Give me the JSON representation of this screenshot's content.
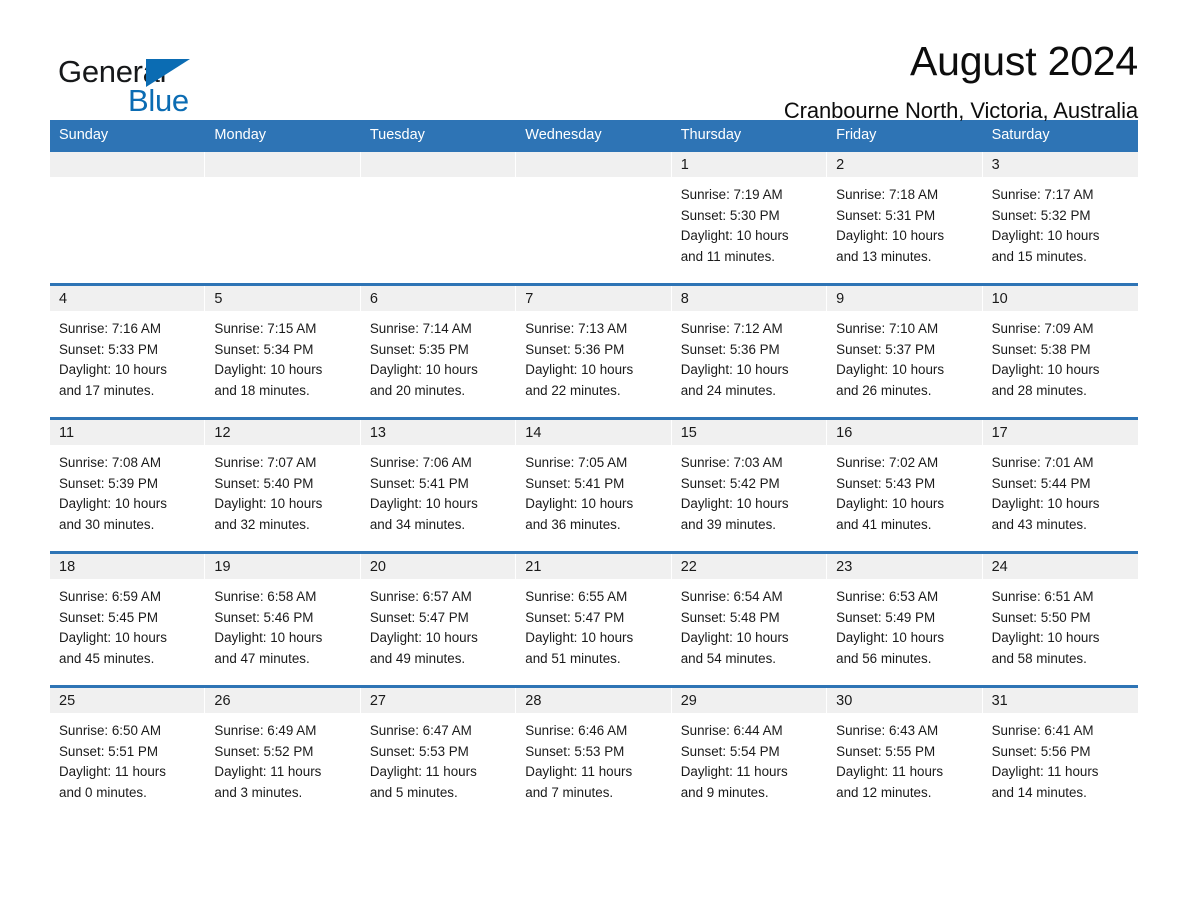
{
  "brand": {
    "word_1": "General",
    "word_2": "Blue",
    "triangle_icon": "triangle-icon",
    "accent_color": "#0b6cb3"
  },
  "header": {
    "title": "August 2024",
    "subtitle": "Cranbourne North, Victoria, Australia"
  },
  "theme": {
    "header_blue": "#2e74b5",
    "date_band_grey": "#f0f0f0",
    "text_color": "#1a1a1a"
  },
  "weekdays": [
    "Sunday",
    "Monday",
    "Tuesday",
    "Wednesday",
    "Thursday",
    "Friday",
    "Saturday"
  ],
  "labels": {
    "sunrise_prefix": "Sunrise:",
    "sunset_prefix": "Sunset:",
    "daylight_prefix": "Daylight:"
  },
  "weeks": [
    [
      {
        "date": "",
        "empty": true
      },
      {
        "date": "",
        "empty": true
      },
      {
        "date": "",
        "empty": true
      },
      {
        "date": "",
        "empty": true
      },
      {
        "date": "1",
        "sunrise": "Sunrise: 7:19 AM",
        "sunset": "Sunset: 5:30 PM",
        "daylight_1": "Daylight: 10 hours",
        "daylight_2": "and 11 minutes."
      },
      {
        "date": "2",
        "sunrise": "Sunrise: 7:18 AM",
        "sunset": "Sunset: 5:31 PM",
        "daylight_1": "Daylight: 10 hours",
        "daylight_2": "and 13 minutes."
      },
      {
        "date": "3",
        "sunrise": "Sunrise: 7:17 AM",
        "sunset": "Sunset: 5:32 PM",
        "daylight_1": "Daylight: 10 hours",
        "daylight_2": "and 15 minutes."
      }
    ],
    [
      {
        "date": "4",
        "sunrise": "Sunrise: 7:16 AM",
        "sunset": "Sunset: 5:33 PM",
        "daylight_1": "Daylight: 10 hours",
        "daylight_2": "and 17 minutes."
      },
      {
        "date": "5",
        "sunrise": "Sunrise: 7:15 AM",
        "sunset": "Sunset: 5:34 PM",
        "daylight_1": "Daylight: 10 hours",
        "daylight_2": "and 18 minutes."
      },
      {
        "date": "6",
        "sunrise": "Sunrise: 7:14 AM",
        "sunset": "Sunset: 5:35 PM",
        "daylight_1": "Daylight: 10 hours",
        "daylight_2": "and 20 minutes."
      },
      {
        "date": "7",
        "sunrise": "Sunrise: 7:13 AM",
        "sunset": "Sunset: 5:36 PM",
        "daylight_1": "Daylight: 10 hours",
        "daylight_2": "and 22 minutes."
      },
      {
        "date": "8",
        "sunrise": "Sunrise: 7:12 AM",
        "sunset": "Sunset: 5:36 PM",
        "daylight_1": "Daylight: 10 hours",
        "daylight_2": "and 24 minutes."
      },
      {
        "date": "9",
        "sunrise": "Sunrise: 7:10 AM",
        "sunset": "Sunset: 5:37 PM",
        "daylight_1": "Daylight: 10 hours",
        "daylight_2": "and 26 minutes."
      },
      {
        "date": "10",
        "sunrise": "Sunrise: 7:09 AM",
        "sunset": "Sunset: 5:38 PM",
        "daylight_1": "Daylight: 10 hours",
        "daylight_2": "and 28 minutes."
      }
    ],
    [
      {
        "date": "11",
        "sunrise": "Sunrise: 7:08 AM",
        "sunset": "Sunset: 5:39 PM",
        "daylight_1": "Daylight: 10 hours",
        "daylight_2": "and 30 minutes."
      },
      {
        "date": "12",
        "sunrise": "Sunrise: 7:07 AM",
        "sunset": "Sunset: 5:40 PM",
        "daylight_1": "Daylight: 10 hours",
        "daylight_2": "and 32 minutes."
      },
      {
        "date": "13",
        "sunrise": "Sunrise: 7:06 AM",
        "sunset": "Sunset: 5:41 PM",
        "daylight_1": "Daylight: 10 hours",
        "daylight_2": "and 34 minutes."
      },
      {
        "date": "14",
        "sunrise": "Sunrise: 7:05 AM",
        "sunset": "Sunset: 5:41 PM",
        "daylight_1": "Daylight: 10 hours",
        "daylight_2": "and 36 minutes."
      },
      {
        "date": "15",
        "sunrise": "Sunrise: 7:03 AM",
        "sunset": "Sunset: 5:42 PM",
        "daylight_1": "Daylight: 10 hours",
        "daylight_2": "and 39 minutes."
      },
      {
        "date": "16",
        "sunrise": "Sunrise: 7:02 AM",
        "sunset": "Sunset: 5:43 PM",
        "daylight_1": "Daylight: 10 hours",
        "daylight_2": "and 41 minutes."
      },
      {
        "date": "17",
        "sunrise": "Sunrise: 7:01 AM",
        "sunset": "Sunset: 5:44 PM",
        "daylight_1": "Daylight: 10 hours",
        "daylight_2": "and 43 minutes."
      }
    ],
    [
      {
        "date": "18",
        "sunrise": "Sunrise: 6:59 AM",
        "sunset": "Sunset: 5:45 PM",
        "daylight_1": "Daylight: 10 hours",
        "daylight_2": "and 45 minutes."
      },
      {
        "date": "19",
        "sunrise": "Sunrise: 6:58 AM",
        "sunset": "Sunset: 5:46 PM",
        "daylight_1": "Daylight: 10 hours",
        "daylight_2": "and 47 minutes."
      },
      {
        "date": "20",
        "sunrise": "Sunrise: 6:57 AM",
        "sunset": "Sunset: 5:47 PM",
        "daylight_1": "Daylight: 10 hours",
        "daylight_2": "and 49 minutes."
      },
      {
        "date": "21",
        "sunrise": "Sunrise: 6:55 AM",
        "sunset": "Sunset: 5:47 PM",
        "daylight_1": "Daylight: 10 hours",
        "daylight_2": "and 51 minutes."
      },
      {
        "date": "22",
        "sunrise": "Sunrise: 6:54 AM",
        "sunset": "Sunset: 5:48 PM",
        "daylight_1": "Daylight: 10 hours",
        "daylight_2": "and 54 minutes."
      },
      {
        "date": "23",
        "sunrise": "Sunrise: 6:53 AM",
        "sunset": "Sunset: 5:49 PM",
        "daylight_1": "Daylight: 10 hours",
        "daylight_2": "and 56 minutes."
      },
      {
        "date": "24",
        "sunrise": "Sunrise: 6:51 AM",
        "sunset": "Sunset: 5:50 PM",
        "daylight_1": "Daylight: 10 hours",
        "daylight_2": "and 58 minutes."
      }
    ],
    [
      {
        "date": "25",
        "sunrise": "Sunrise: 6:50 AM",
        "sunset": "Sunset: 5:51 PM",
        "daylight_1": "Daylight: 11 hours",
        "daylight_2": "and 0 minutes."
      },
      {
        "date": "26",
        "sunrise": "Sunrise: 6:49 AM",
        "sunset": "Sunset: 5:52 PM",
        "daylight_1": "Daylight: 11 hours",
        "daylight_2": "and 3 minutes."
      },
      {
        "date": "27",
        "sunrise": "Sunrise: 6:47 AM",
        "sunset": "Sunset: 5:53 PM",
        "daylight_1": "Daylight: 11 hours",
        "daylight_2": "and 5 minutes."
      },
      {
        "date": "28",
        "sunrise": "Sunrise: 6:46 AM",
        "sunset": "Sunset: 5:53 PM",
        "daylight_1": "Daylight: 11 hours",
        "daylight_2": "and 7 minutes."
      },
      {
        "date": "29",
        "sunrise": "Sunrise: 6:44 AM",
        "sunset": "Sunset: 5:54 PM",
        "daylight_1": "Daylight: 11 hours",
        "daylight_2": "and 9 minutes."
      },
      {
        "date": "30",
        "sunrise": "Sunrise: 6:43 AM",
        "sunset": "Sunset: 5:55 PM",
        "daylight_1": "Daylight: 11 hours",
        "daylight_2": "and 12 minutes."
      },
      {
        "date": "31",
        "sunrise": "Sunrise: 6:41 AM",
        "sunset": "Sunset: 5:56 PM",
        "daylight_1": "Daylight: 11 hours",
        "daylight_2": "and 14 minutes."
      }
    ]
  ]
}
